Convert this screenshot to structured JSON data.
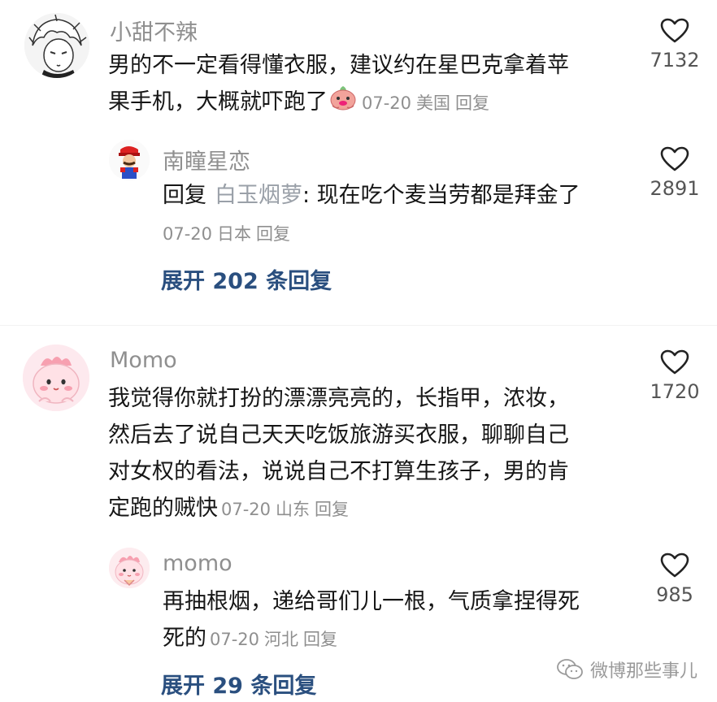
{
  "comments": [
    {
      "username": "小甜不辣",
      "text": "男的不一定看得懂衣服，建议约在星巴克拿着苹果手机，大概就吓跑了",
      "line1": "男的不一定看得懂衣服，建议约在星巴克拿着苹",
      "line2": "果手机，大概就吓跑了",
      "date": "07-20",
      "location": "美国",
      "reply_label": "回复",
      "likes": "7132",
      "replies": [
        {
          "username": "南瞳星恋",
          "reply_prefix": "回复",
          "reply_target": "白玉烟萝",
          "text": ": 现在吃个麦当劳都是拜金了",
          "date": "07-20",
          "location": "日本",
          "reply_label": "回复",
          "likes": "2891"
        }
      ],
      "expand_label": "展开 202 条回复"
    },
    {
      "username": "Momo",
      "line1": "我觉得你就打扮的漂漂亮亮的，长指甲，浓妆，",
      "line2": "然后去了说自己天天吃饭旅游买衣服，聊聊自己",
      "line3": "对女权的看法，说说自己不打算生孩子，男的肯",
      "line4": "定跑的贼快",
      "date": "07-20",
      "location": "山东",
      "reply_label": "回复",
      "likes": "1720",
      "replies": [
        {
          "username": "momo",
          "line1": "再抽根烟，递给哥们儿一根，气质拿捏得死",
          "line2": "死的",
          "date": "07-20",
          "location": "河北",
          "reply_label": "回复",
          "likes": "985"
        }
      ],
      "expand_label": "展开 29 条回复"
    }
  ],
  "watermark": "微博那些事儿",
  "icons": {
    "like": "heart-outline-icon",
    "inline_emoji": "pig-face-emoji-icon",
    "watermark": "wechat-icon"
  }
}
